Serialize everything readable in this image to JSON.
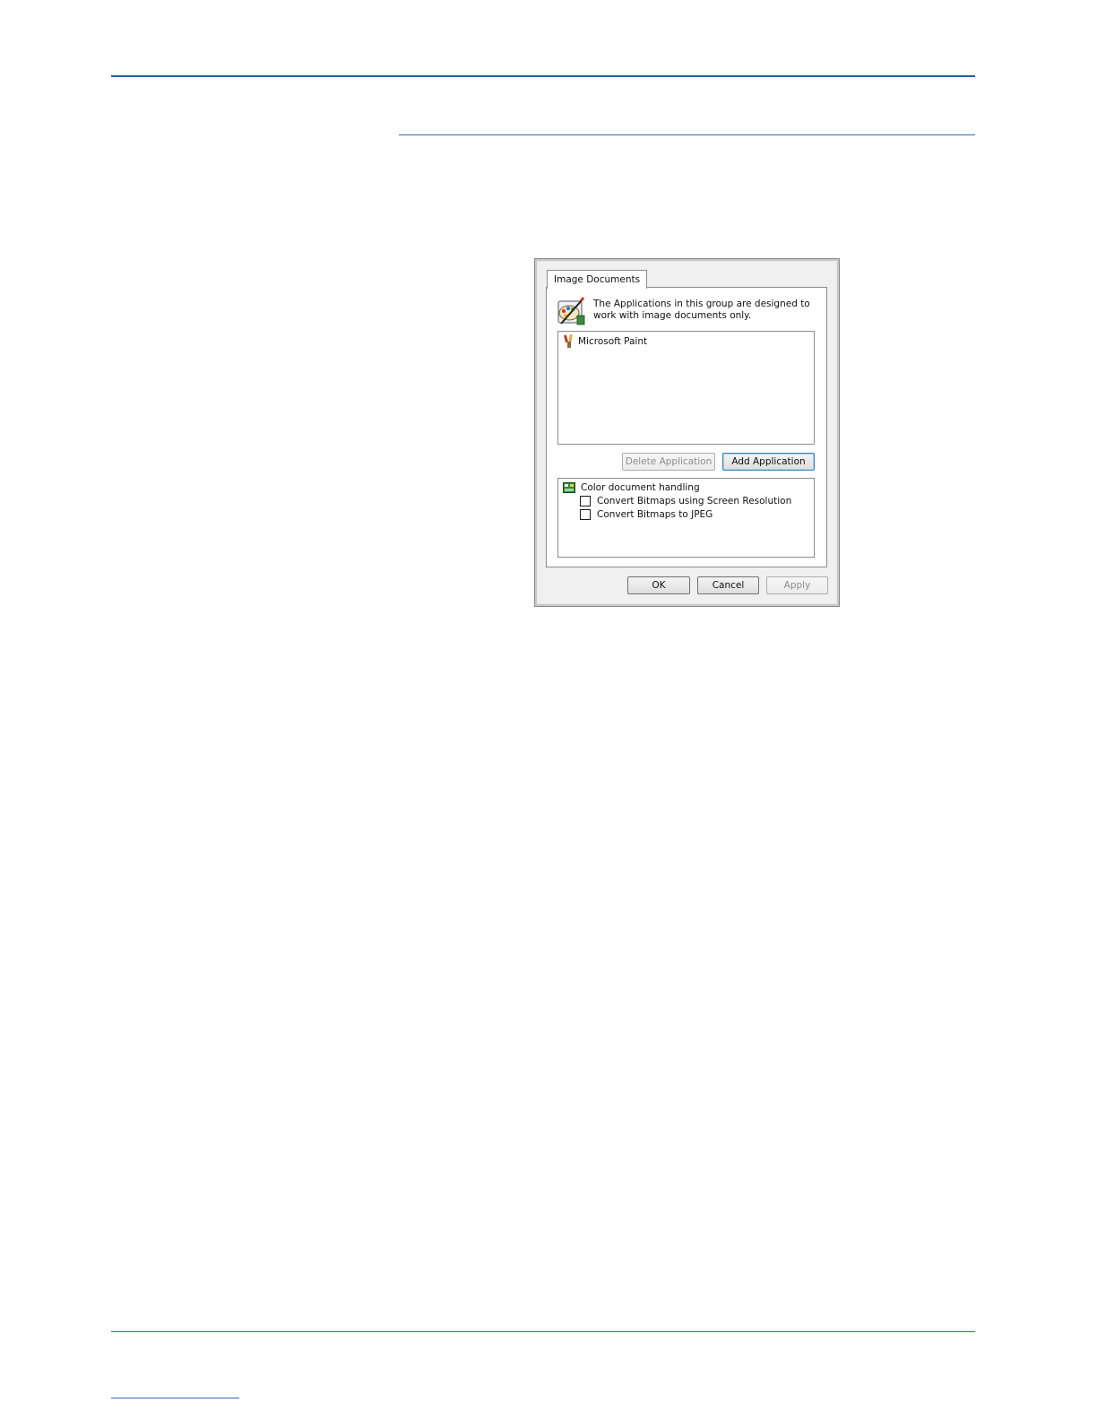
{
  "dialog": {
    "tab_label": "Image Documents",
    "group_description": "The Applications in this group are designed to work with image documents only.",
    "applications": [
      {
        "name": "Microsoft Paint",
        "icon": "paint-brush-icon"
      }
    ],
    "delete_button_label": "Delete Application",
    "add_button_label": "Add Application",
    "options": {
      "header": "Color document handling",
      "header_icon": "color-document-icon",
      "items": [
        {
          "label": "Convert Bitmaps using Screen Resolution",
          "checked": false
        },
        {
          "label": "Convert Bitmaps to JPEG",
          "checked": false
        }
      ]
    },
    "ok_label": "OK",
    "cancel_label": "Cancel",
    "apply_label": "Apply"
  }
}
